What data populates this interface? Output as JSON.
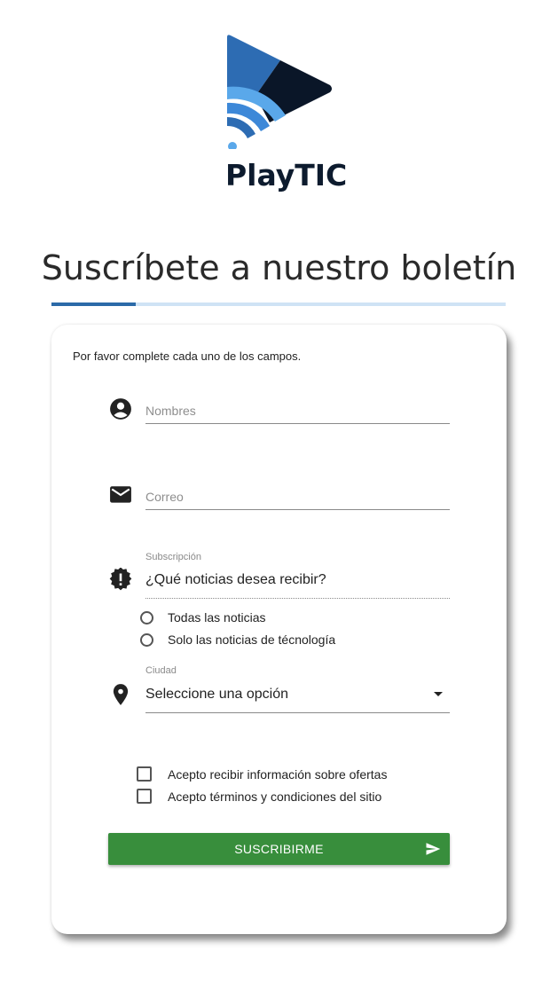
{
  "brand": {
    "name": "PlayTIC",
    "colors": {
      "blue": "#2b6aa8",
      "navy": "#0a1628",
      "light_blue": "#5aa8ea"
    }
  },
  "page": {
    "title": "Suscríbete a nuestro boletín",
    "accent_color": "#2b6aa8",
    "bar_color": "#cfe3f5"
  },
  "form": {
    "intro": "Por favor complete cada uno de los campos.",
    "nombres": {
      "placeholder": "Nombres",
      "value": "",
      "icon": "account-circle-icon"
    },
    "correo": {
      "placeholder": "Correo",
      "value": "",
      "icon": "mail-icon"
    },
    "subscripcion": {
      "label": "Subscripción",
      "question": "¿Qué noticias desea recibir?",
      "icon": "alert-badge-icon",
      "options": [
        "Todas las noticias",
        "Solo las noticias de técnología"
      ],
      "selected": null
    },
    "ciudad": {
      "label": "Ciudad",
      "selected": "Seleccione una opción",
      "icon": "location-pin-icon"
    },
    "checks": [
      {
        "label": "Acepto recibir información sobre ofertas",
        "checked": false
      },
      {
        "label": "Acepto términos y condiciones del sitio",
        "checked": false
      }
    ],
    "submit": {
      "label": "SUSCRIBIRME",
      "color": "#388e3c",
      "icon": "send-icon"
    }
  }
}
